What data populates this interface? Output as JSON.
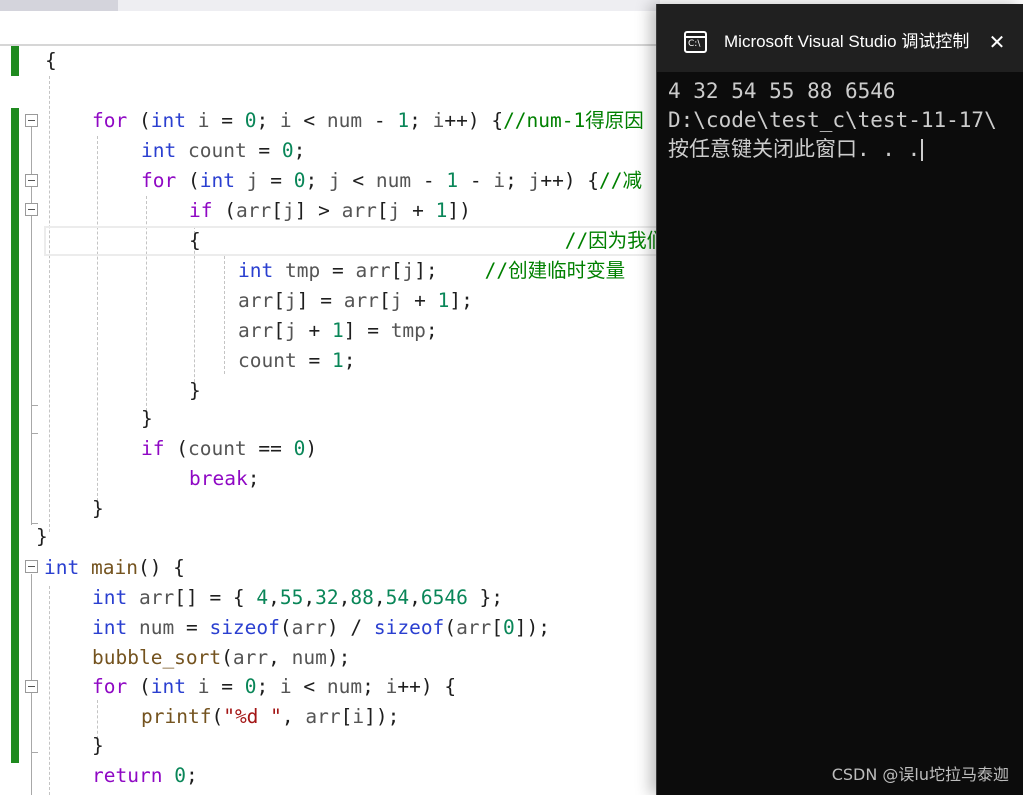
{
  "editor": {
    "lines": [
      [
        [
          "{",
          "pn"
        ]
      ],
      [],
      [
        [
          "for",
          "ctl"
        ],
        [
          " (",
          "pn"
        ],
        [
          "int",
          "kw"
        ],
        [
          " ",
          "pn"
        ],
        [
          "i",
          "var"
        ],
        [
          " = ",
          "pn"
        ],
        [
          "0",
          "num"
        ],
        [
          "; ",
          "pn"
        ],
        [
          "i",
          "var"
        ],
        [
          " < ",
          "pn"
        ],
        [
          "num",
          "var"
        ],
        [
          " - ",
          "pn"
        ],
        [
          "1",
          "num"
        ],
        [
          "; ",
          "pn"
        ],
        [
          "i",
          "var"
        ],
        [
          "++) {",
          "pn"
        ],
        [
          "//num-1得原因",
          "cm"
        ]
      ],
      [
        [
          "int",
          "kw"
        ],
        [
          " ",
          "pn"
        ],
        [
          "count",
          "var"
        ],
        [
          " = ",
          "pn"
        ],
        [
          "0",
          "num"
        ],
        [
          ";",
          "pn"
        ]
      ],
      [
        [
          "for",
          "ctl"
        ],
        [
          " (",
          "pn"
        ],
        [
          "int",
          "kw"
        ],
        [
          " ",
          "pn"
        ],
        [
          "j",
          "var"
        ],
        [
          " = ",
          "pn"
        ],
        [
          "0",
          "num"
        ],
        [
          "; ",
          "pn"
        ],
        [
          "j",
          "var"
        ],
        [
          " < ",
          "pn"
        ],
        [
          "num",
          "var"
        ],
        [
          " - ",
          "pn"
        ],
        [
          "1",
          "num"
        ],
        [
          " - ",
          "pn"
        ],
        [
          "i",
          "var"
        ],
        [
          "; ",
          "pn"
        ],
        [
          "j",
          "var"
        ],
        [
          "++) {",
          "pn"
        ],
        [
          "//减",
          "cm"
        ]
      ],
      [
        [
          "if",
          "ctl"
        ],
        [
          " (",
          "pn"
        ],
        [
          "arr",
          "var"
        ],
        [
          "[",
          "pn"
        ],
        [
          "j",
          "var"
        ],
        [
          "] > ",
          "pn"
        ],
        [
          "arr",
          "var"
        ],
        [
          "[",
          "pn"
        ],
        [
          "j",
          "var"
        ],
        [
          " + ",
          "pn"
        ],
        [
          "1",
          "num"
        ],
        [
          "])",
          "pn"
        ]
      ],
      [
        [
          "{",
          "pn"
        ],
        [
          "                               ",
          "pn"
        ],
        [
          "//因为我们",
          "cm"
        ]
      ],
      [
        [
          "int",
          "kw"
        ],
        [
          " ",
          "pn"
        ],
        [
          "tmp",
          "var"
        ],
        [
          " = ",
          "pn"
        ],
        [
          "arr",
          "var"
        ],
        [
          "[",
          "pn"
        ],
        [
          "j",
          "var"
        ],
        [
          "];    ",
          "pn"
        ],
        [
          "//创建临时变量",
          "cm"
        ]
      ],
      [
        [
          "arr",
          "var"
        ],
        [
          "[",
          "pn"
        ],
        [
          "j",
          "var"
        ],
        [
          "] = ",
          "pn"
        ],
        [
          "arr",
          "var"
        ],
        [
          "[",
          "pn"
        ],
        [
          "j",
          "var"
        ],
        [
          " + ",
          "pn"
        ],
        [
          "1",
          "num"
        ],
        [
          "];",
          "pn"
        ]
      ],
      [
        [
          "arr",
          "var"
        ],
        [
          "[",
          "pn"
        ],
        [
          "j",
          "var"
        ],
        [
          " + ",
          "pn"
        ],
        [
          "1",
          "num"
        ],
        [
          "] = ",
          "pn"
        ],
        [
          "tmp",
          "var"
        ],
        [
          ";",
          "pn"
        ]
      ],
      [
        [
          "count",
          "var"
        ],
        [
          " = ",
          "pn"
        ],
        [
          "1",
          "num"
        ],
        [
          ";",
          "pn"
        ]
      ],
      [
        [
          "}",
          "pn"
        ]
      ],
      [
        [
          "}",
          "pn"
        ]
      ],
      [
        [
          "if",
          "ctl"
        ],
        [
          " (",
          "pn"
        ],
        [
          "count",
          "var"
        ],
        [
          " == ",
          "pn"
        ],
        [
          "0",
          "num"
        ],
        [
          ")",
          "pn"
        ]
      ],
      [
        [
          "break",
          "ctl"
        ],
        [
          ";",
          "pn"
        ]
      ],
      [
        [
          "}",
          "pn"
        ]
      ],
      [
        [
          "}",
          "pn"
        ]
      ],
      [
        [
          "int",
          "kw"
        ],
        [
          " ",
          "pn"
        ],
        [
          "main",
          "fn"
        ],
        [
          "() {",
          "pn"
        ]
      ],
      [
        [
          "int",
          "kw"
        ],
        [
          " ",
          "pn"
        ],
        [
          "arr",
          "var"
        ],
        [
          "[] = { ",
          "pn"
        ],
        [
          "4",
          "num"
        ],
        [
          ",",
          "pn"
        ],
        [
          "55",
          "num"
        ],
        [
          ",",
          "pn"
        ],
        [
          "32",
          "num"
        ],
        [
          ",",
          "pn"
        ],
        [
          "88",
          "num"
        ],
        [
          ",",
          "pn"
        ],
        [
          "54",
          "num"
        ],
        [
          ",",
          "pn"
        ],
        [
          "6546",
          "num"
        ],
        [
          " };",
          "pn"
        ]
      ],
      [
        [
          "int",
          "kw"
        ],
        [
          " ",
          "pn"
        ],
        [
          "num",
          "var"
        ],
        [
          " = ",
          "pn"
        ],
        [
          "sizeof",
          "kw"
        ],
        [
          "(",
          "pn"
        ],
        [
          "arr",
          "var"
        ],
        [
          ") / ",
          "pn"
        ],
        [
          "sizeof",
          "kw"
        ],
        [
          "(",
          "pn"
        ],
        [
          "arr",
          "var"
        ],
        [
          "[",
          "pn"
        ],
        [
          "0",
          "num"
        ],
        [
          "]);",
          "pn"
        ]
      ],
      [
        [
          "bubble_sort",
          "fn"
        ],
        [
          "(",
          "pn"
        ],
        [
          "arr",
          "var"
        ],
        [
          ", ",
          "pn"
        ],
        [
          "num",
          "var"
        ],
        [
          ");",
          "pn"
        ]
      ],
      [
        [
          "for",
          "ctl"
        ],
        [
          " (",
          "pn"
        ],
        [
          "int",
          "kw"
        ],
        [
          " ",
          "pn"
        ],
        [
          "i",
          "var"
        ],
        [
          " = ",
          "pn"
        ],
        [
          "0",
          "num"
        ],
        [
          "; ",
          "pn"
        ],
        [
          "i",
          "var"
        ],
        [
          " < ",
          "pn"
        ],
        [
          "num",
          "var"
        ],
        [
          "; ",
          "pn"
        ],
        [
          "i",
          "var"
        ],
        [
          "++) {",
          "pn"
        ]
      ],
      [
        [
          "printf",
          "fn"
        ],
        [
          "(",
          "pn"
        ],
        [
          "\"%d \"",
          "str"
        ],
        [
          ", ",
          "pn"
        ],
        [
          "arr",
          "var"
        ],
        [
          "[",
          "pn"
        ],
        [
          "i",
          "var"
        ],
        [
          "]);",
          "pn"
        ]
      ],
      [
        [
          "}",
          "pn"
        ]
      ],
      [
        [
          "return",
          "ctl"
        ],
        [
          " ",
          "pn"
        ],
        [
          "0",
          "num"
        ],
        [
          ";",
          "pn"
        ]
      ]
    ]
  },
  "console": {
    "title": "Microsoft Visual Studio 调试控制台",
    "close_glyph": "✕",
    "app_icon_text": "C:\\",
    "lines": [
      "4 32 54 55 88 6546",
      "D:\\code\\test_c\\test-11-17\\",
      "按任意键关闭此窗口. . ."
    ]
  },
  "watermark": "CSDN @误lu坨拉马泰迦",
  "colors": {
    "keyword": "#2a3fd0",
    "control": "#8f08c4",
    "comment": "#008000",
    "string": "#a31515",
    "function": "#74531f",
    "change_bar": "#1f8a1f",
    "console_bg": "#0c0c0c",
    "console_titlebar": "#202020"
  }
}
